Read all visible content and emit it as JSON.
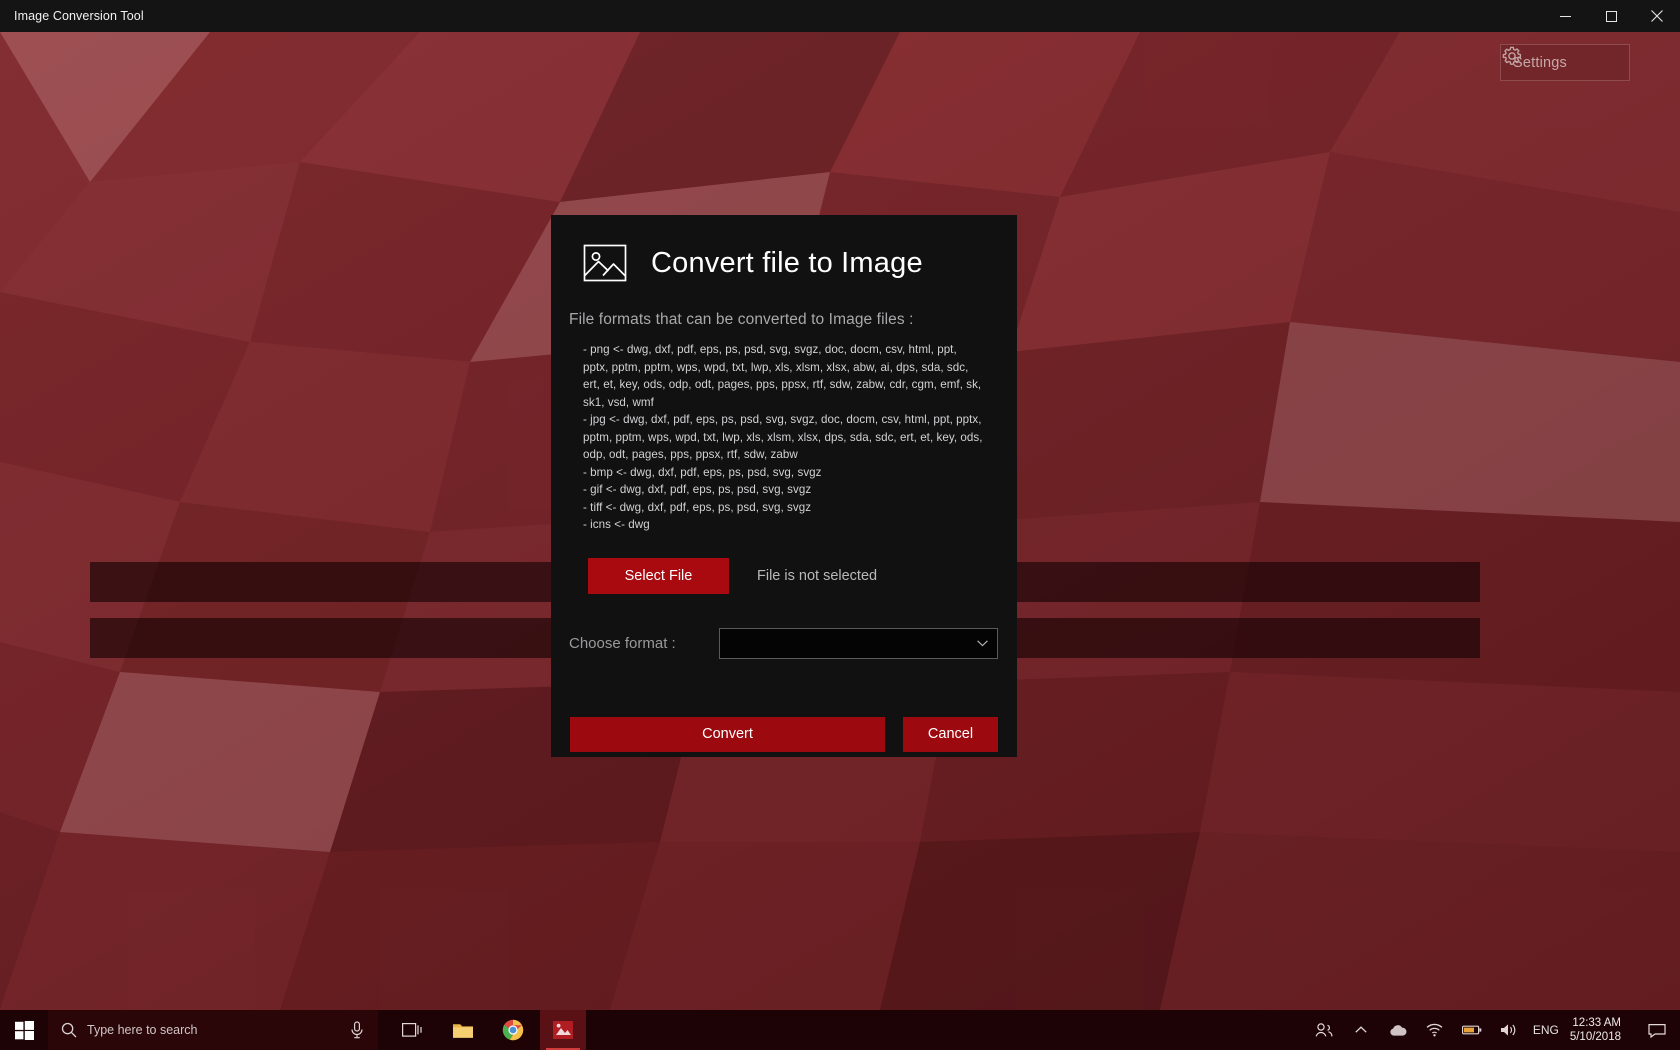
{
  "window": {
    "title": "Image Conversion Tool",
    "minimize_label": "Minimize",
    "maximize_label": "Maximize",
    "close_label": "Close"
  },
  "desktop": {
    "settings_button_label": "Settings",
    "accent_red": "#a80a0f",
    "wallpaper_base": "#7d2b2f"
  },
  "dialog": {
    "title": "Convert file to Image",
    "subtitle": "File formats that can be converted to Image files :",
    "format_lines": [
      "- png <- dwg, dxf, pdf, eps, ps, psd, svg, svgz, doc, docm, csv, html, ppt, pptx, pptm, pptm, wps, wpd, txt, lwp, xls, xlsm, xlsx, abw, ai, dps, sda, sdc, ert, et, key, ods, odp, odt, pages, pps, ppsx, rtf, sdw, zabw, cdr, cgm, emf, sk, sk1, vsd, wmf",
      "- jpg <- dwg, dxf, pdf, eps, ps, psd, svg, svgz, doc, docm, csv, html, ppt, pptx, pptm, pptm, wps, wpd, txt, lwp, xls, xlsm, xlsx, dps, sda, sdc, ert, et, key, ods, odp, odt, pages, pps, ppsx, rtf, sdw, zabw",
      "- bmp <- dwg, dxf, pdf, eps, ps, psd, svg, svgz",
      "- gif <- dwg, dxf, pdf, eps, ps, psd, svg, svgz",
      "- tiff <- dwg, dxf, pdf, eps, ps, psd, svg, svgz",
      "- icns <- dwg"
    ],
    "select_file_label": "Select File",
    "file_status": "File is not selected",
    "format_label": "Choose format :",
    "format_value": "",
    "format_placeholder": "",
    "convert_label": "Convert",
    "cancel_label": "Cancel"
  },
  "taskbar": {
    "search_placeholder": "Type here to search",
    "language": "ENG",
    "time": "12:33 AM",
    "date": "5/10/2018"
  }
}
